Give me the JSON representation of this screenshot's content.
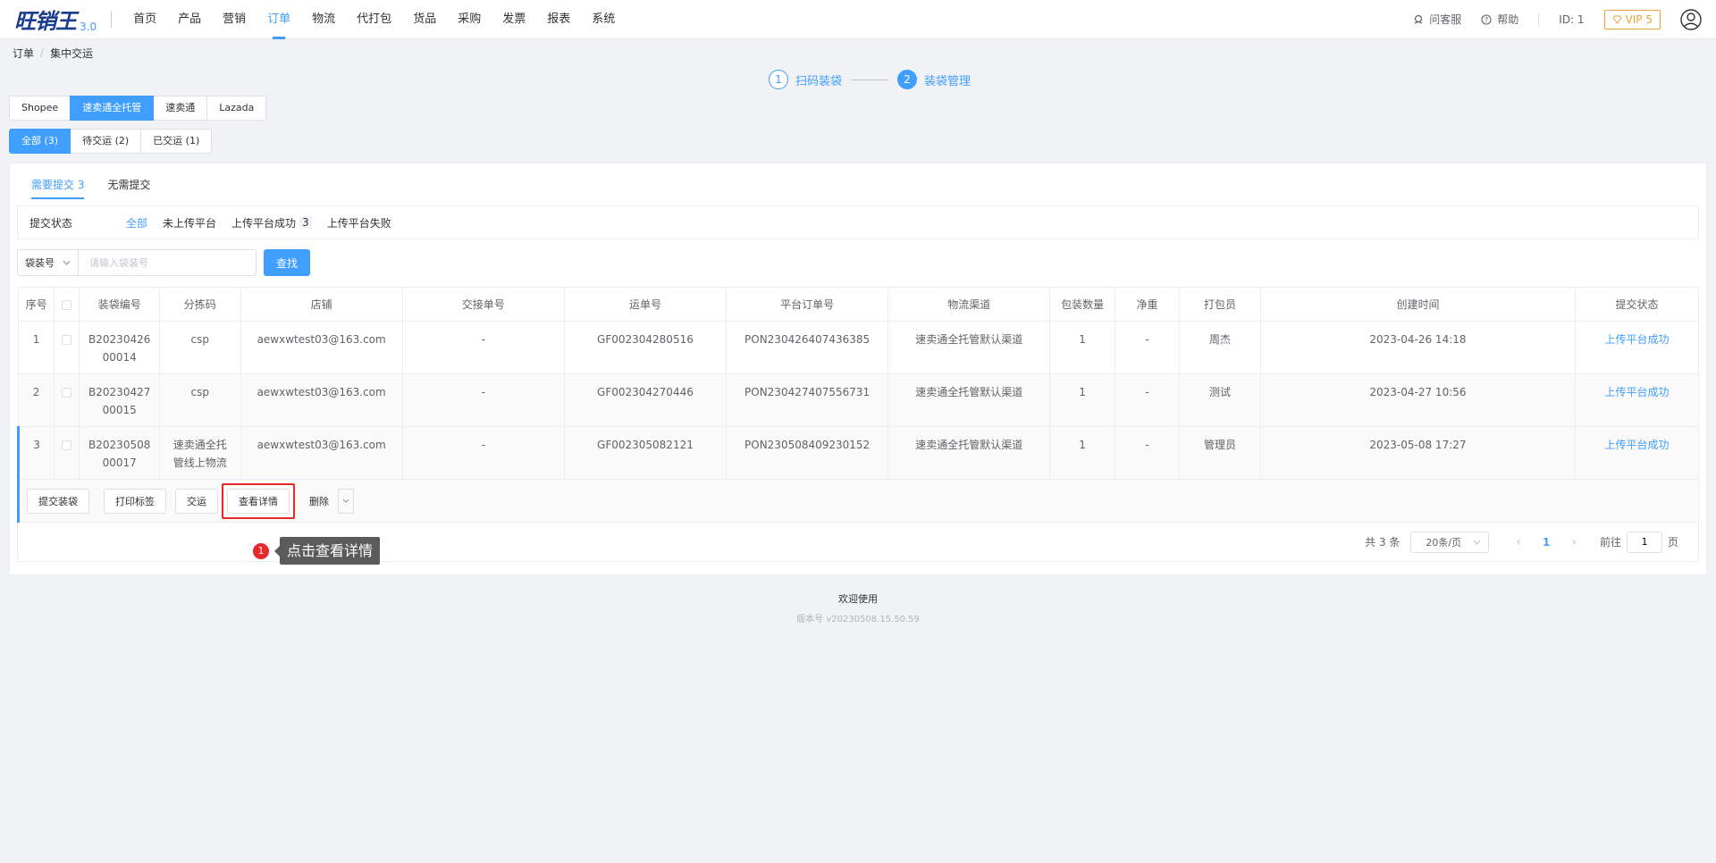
{
  "brand": {
    "logo_text": "旺销王",
    "version": "3.0"
  },
  "nav": {
    "items": [
      {
        "label": "首页",
        "active": false
      },
      {
        "label": "产品",
        "active": false
      },
      {
        "label": "营销",
        "active": false
      },
      {
        "label": "订单",
        "active": true
      },
      {
        "label": "物流",
        "active": false
      },
      {
        "label": "代打包",
        "active": false
      },
      {
        "label": "货品",
        "active": false
      },
      {
        "label": "采购",
        "active": false
      },
      {
        "label": "发票",
        "active": false
      },
      {
        "label": "报表",
        "active": false
      },
      {
        "label": "系统",
        "active": false
      }
    ]
  },
  "topright": {
    "service": "问客服",
    "help": "帮助",
    "user_id": "ID: 1",
    "vip": "VIP 5"
  },
  "breadcrumb": {
    "root": "订单",
    "current": "集中交运"
  },
  "steps": [
    {
      "num": "1",
      "label": "扫码装袋"
    },
    {
      "num": "2",
      "label": "装袋管理"
    }
  ],
  "platform_tabs": [
    "Shopee",
    "速卖通全托管",
    "速卖通",
    "Lazada"
  ],
  "status_tabs": [
    "全部 (3)",
    "待交运 (2)",
    "已交运 (1)"
  ],
  "sub_tabs": [
    "需要提交 3",
    "无需提交"
  ],
  "filter": {
    "label": "提交状态",
    "options": [
      {
        "label": "全部",
        "count": ""
      },
      {
        "label": "未上传平台",
        "count": ""
      },
      {
        "label": "上传平台成功",
        "count": "3"
      },
      {
        "label": "上传平台失败",
        "count": ""
      }
    ]
  },
  "search": {
    "select_label": "袋装号",
    "placeholder": "请输入袋装号",
    "button": "查找"
  },
  "table": {
    "headers": [
      "序号",
      "",
      "装袋编号",
      "分拣码",
      "店铺",
      "交接单号",
      "运单号",
      "平台订单号",
      "物流渠道",
      "包装数量",
      "净重",
      "打包员",
      "创建时间",
      "提交状态"
    ],
    "rows": [
      {
        "no": "1",
        "bag_a": "B20230426",
        "bag_b": "00014",
        "sort_a": "csp",
        "sort_b": "",
        "shop": "aewxwtest03@163.com",
        "handover": "-",
        "waybill": "GF002304280516",
        "order": "PON230426407436385",
        "channel": "速卖通全托管默认渠道",
        "qty": "1",
        "weight": "-",
        "packer": "周杰",
        "created": "2023-04-26 14:18",
        "status": "上传平台成功"
      },
      {
        "no": "2",
        "bag_a": "B20230427",
        "bag_b": "00015",
        "sort_a": "csp",
        "sort_b": "",
        "shop": "aewxwtest03@163.com",
        "handover": "-",
        "waybill": "GF002304270446",
        "order": "PON230427407556731",
        "channel": "速卖通全托管默认渠道",
        "qty": "1",
        "weight": "-",
        "packer": "测试",
        "created": "2023-04-27 10:56",
        "status": "上传平台成功"
      },
      {
        "no": "3",
        "bag_a": "B20230508",
        "bag_b": "00017",
        "sort_a": "速卖通全托",
        "sort_b": "管线上物流",
        "shop": "aewxwtest03@163.com",
        "handover": "-",
        "waybill": "GF002305082121",
        "order": "PON230508409230152",
        "channel": "速卖通全托管默认渠道",
        "qty": "1",
        "weight": "-",
        "packer": "管理员",
        "created": "2023-05-08 17:27",
        "status": "上传平台成功"
      }
    ]
  },
  "row_actions": {
    "submit": "提交装袋",
    "print": "打印标签",
    "handover": "交运",
    "details": "查看详情",
    "delete": "删除"
  },
  "pagination": {
    "total": "共 3 条",
    "page_size": "20条/页",
    "current": "1",
    "goto_prefix": "前往",
    "goto_value": "1",
    "goto_suffix": "页"
  },
  "tooltip": {
    "badge": "1",
    "text": "点击查看详情"
  },
  "footer": {
    "welcome": "欢迎使用",
    "version": "版本号 v20230508.15.50.59"
  },
  "colors": {
    "primary": "#409eff",
    "highlight": "#e5292b",
    "vip": "#e6a23c"
  }
}
